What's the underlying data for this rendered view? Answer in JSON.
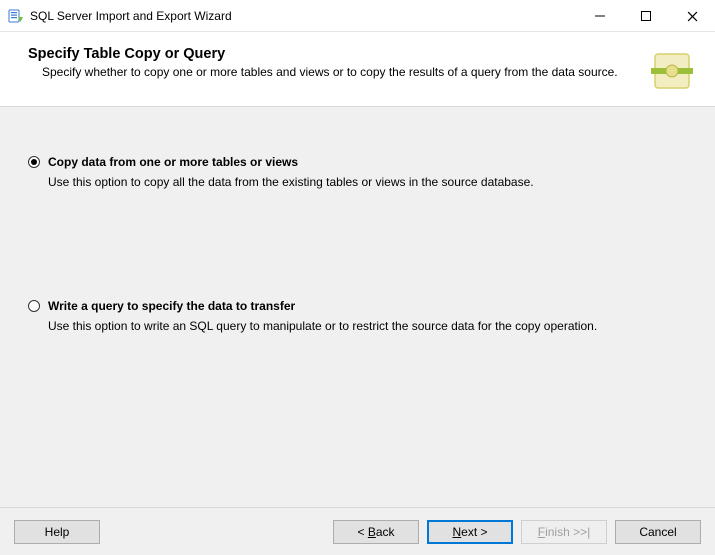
{
  "window": {
    "title": "SQL Server Import and Export Wizard"
  },
  "header": {
    "title": "Specify Table Copy or Query",
    "description": "Specify whether to copy one or more tables and views or to copy the results of a query from the data source."
  },
  "options": {
    "copy": {
      "label": "Copy data from one or more tables or views",
      "description": "Use this option to copy all the data from the existing tables or views in the source database.",
      "selected": true
    },
    "query": {
      "label": "Write a query to specify the data to transfer",
      "description": "Use this option to write an SQL query to manipulate or to restrict the source data for the copy operation.",
      "selected": false
    }
  },
  "buttons": {
    "help": "Help",
    "back_prefix": "< ",
    "back_u": "B",
    "back_rest": "ack",
    "next_u": "N",
    "next_rest": "ext >",
    "finish_pre": "",
    "finish_u": "F",
    "finish_rest": "inish >>|",
    "cancel": "Cancel"
  }
}
